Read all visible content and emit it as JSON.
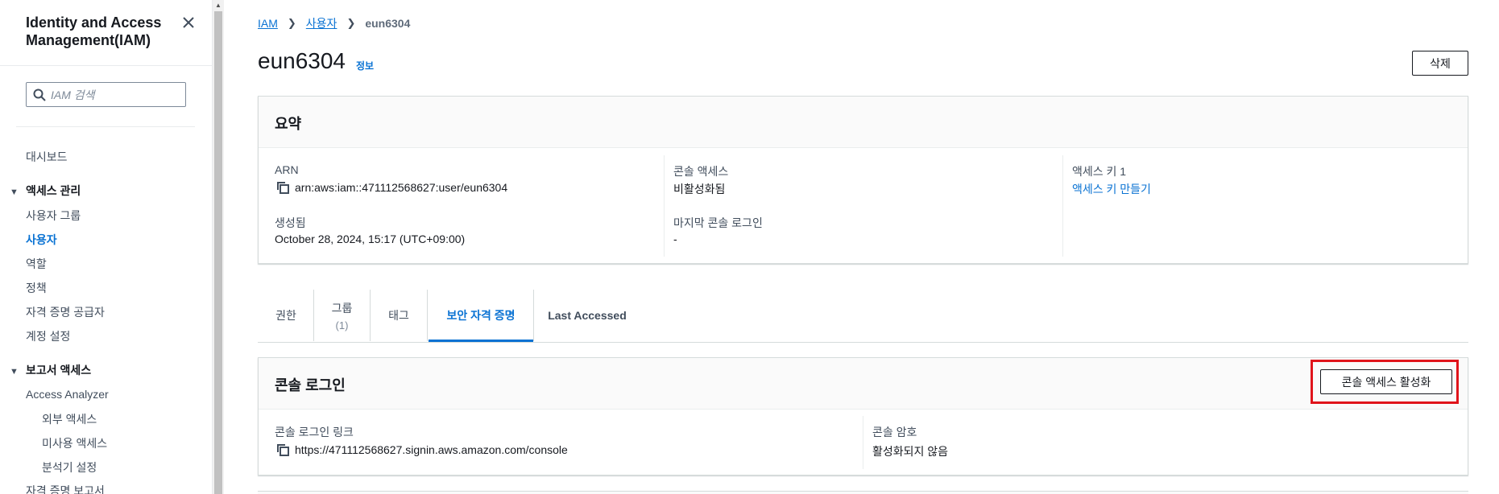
{
  "sidebar": {
    "title": "Identity and Access Management(IAM)",
    "search_placeholder": "IAM 검색",
    "dashboard": "대시보드",
    "access_management": {
      "label": "액세스 관리",
      "items": [
        "사용자 그룹",
        "사용자",
        "역할",
        "정책",
        "자격 증명 공급자",
        "계정 설정"
      ]
    },
    "access_reports": {
      "label": "보고서 액세스",
      "analyzer": "Access Analyzer",
      "analyzer_items": [
        "외부 액세스",
        "미사용 액세스",
        "분석기 설정"
      ],
      "credential_report": "자격 증명 보고서"
    }
  },
  "breadcrumb": {
    "root": "IAM",
    "section": "사용자",
    "current": "eun6304"
  },
  "header": {
    "title": "eun6304",
    "info_link": "정보",
    "delete_button": "삭제"
  },
  "summary": {
    "title": "요약",
    "arn_label": "ARN",
    "arn_value": "arn:aws:iam::471112568627:user/eun6304",
    "created_label": "생성됨",
    "created_value": "October 28, 2024, 15:17 (UTC+09:00)",
    "console_access_label": "콘솔 액세스",
    "console_access_value": "비활성화됨",
    "last_login_label": "마지막 콘솔 로그인",
    "last_login_value": "-",
    "access_key_label": "액세스 키 1",
    "access_key_link": "액세스 키 만들기"
  },
  "tabs": {
    "permissions": "권한",
    "groups": "그룹",
    "groups_count": "(1)",
    "tags": "태그",
    "security_credentials": "보안 자격 증명",
    "last_accessed": "Last Accessed"
  },
  "console_signin": {
    "title": "콘솔 로그인",
    "enable_button": "콘솔 액세스 활성화",
    "link_label": "콘솔 로그인 링크",
    "link_value": "https://471112568627.signin.aws.amazon.com/console",
    "password_label": "콘솔 암호",
    "password_value": "활성화되지 않음"
  },
  "colors": {
    "link": "#0972d3",
    "highlight": "#e0141b"
  }
}
